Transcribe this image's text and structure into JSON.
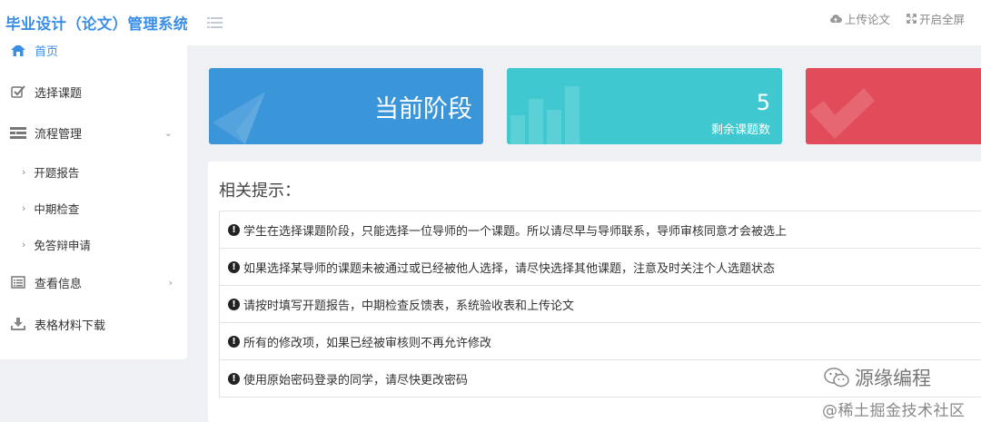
{
  "header": {
    "brand": "毕业设计（论文）管理系统",
    "upload_label": "上传论文",
    "fullscreen_label": "开启全屏"
  },
  "sidebar": {
    "items": [
      {
        "label": "首页",
        "icon": "home-icon"
      },
      {
        "label": "选择课题",
        "icon": "checkbox-icon"
      },
      {
        "label": "流程管理",
        "icon": "list-icon"
      },
      {
        "label": "查看信息",
        "icon": "document-icon"
      },
      {
        "label": "表格材料下载",
        "icon": "download-icon"
      }
    ],
    "sub_items": [
      "开题报告",
      "中期检查",
      "免答辩申请"
    ]
  },
  "cards": {
    "stage_title": "当前阶段",
    "remaining_count": "5",
    "remaining_label": "剩余课题数"
  },
  "tips": {
    "title": "相关提示：",
    "items": [
      "学生在选择课题阶段，只能选择一位导师的一个课题。所以请尽早与导师联系，导师审核同意才会被选上",
      "如果选择某导师的课题未被通过或已经被他人选择，请尽快选择其他课题，注意及时关注个人选题状态",
      "请按时填写开题报告，中期检查反馈表，系统验收表和上传论文",
      "所有的修改项，如果已经被审核则不再允许修改",
      "使用原始密码登录的同学，请尽快更改密码"
    ]
  },
  "watermark": {
    "line1": "源缘编程",
    "line2": "@稀土掘金技术社区"
  },
  "colors": {
    "brand": "#3a8ee6",
    "card_blue": "#3b96d9",
    "card_cyan": "#3fc8d0",
    "card_red": "#e24c5a"
  }
}
